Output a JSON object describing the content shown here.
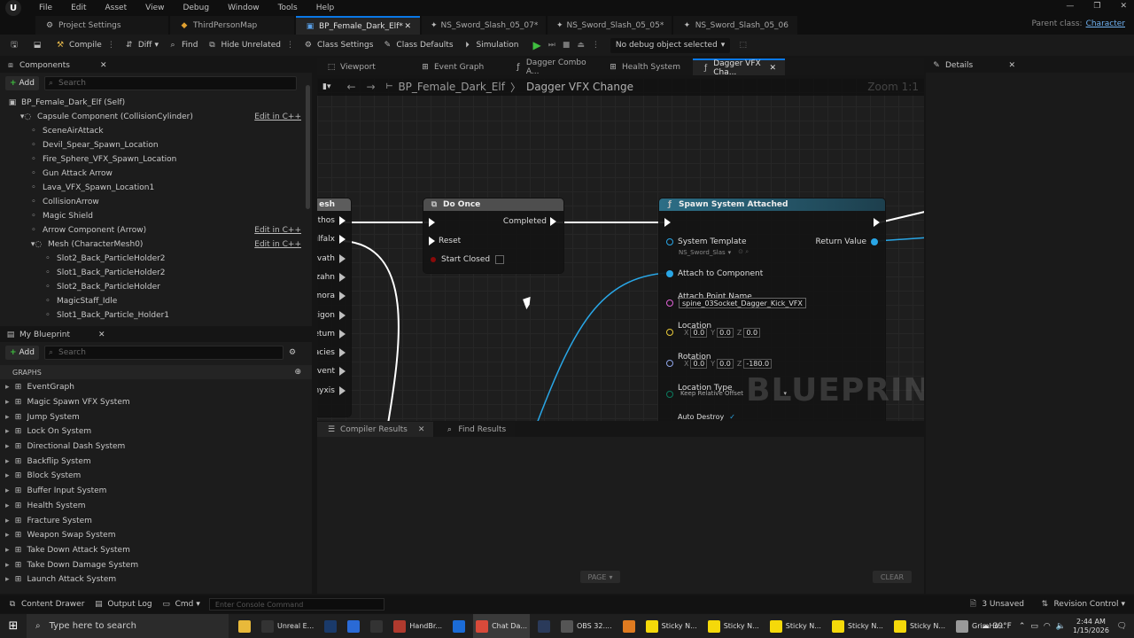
{
  "menu": {
    "items": [
      "File",
      "Edit",
      "Asset",
      "View",
      "Debug",
      "Window",
      "Tools",
      "Help"
    ]
  },
  "tabs": [
    {
      "label": "Project Settings"
    },
    {
      "label": "ThirdPersonMap"
    },
    {
      "label": "BP_Female_Dark_Elf*"
    },
    {
      "label": "NS_Sword_Slash_05_07*"
    },
    {
      "label": "NS_Sword_Slash_05_05*"
    },
    {
      "label": "NS_Sword_Slash_05_06"
    }
  ],
  "parent_class": {
    "label": "Parent class:",
    "value": "Character"
  },
  "toolbar": {
    "compile": "Compile",
    "diff": "Diff",
    "find": "Find",
    "hide_unrelated": "Hide Unrelated",
    "class_settings": "Class Settings",
    "class_defaults": "Class Defaults",
    "simulation": "Simulation",
    "debug_object": "No debug object selected"
  },
  "components": {
    "title": "Components",
    "add": "Add",
    "search_placeholder": "Search",
    "items": [
      {
        "label": "BP_Female_Dark_Elf (Self)",
        "indent": 0,
        "edit": ""
      },
      {
        "label": "Capsule Component (CollisionCylinder)",
        "indent": 1,
        "edit": "Edit in C++"
      },
      {
        "label": "SceneAirAttack",
        "indent": 2,
        "edit": ""
      },
      {
        "label": "Devil_Spear_Spawn_Location",
        "indent": 2,
        "edit": ""
      },
      {
        "label": "Fire_Sphere_VFX_Spawn_Location",
        "indent": 2,
        "edit": ""
      },
      {
        "label": "Gun Attack Arrow",
        "indent": 2,
        "edit": ""
      },
      {
        "label": "Lava_VFX_Spawn_Location1",
        "indent": 2,
        "edit": ""
      },
      {
        "label": "CollisionArrow",
        "indent": 2,
        "edit": ""
      },
      {
        "label": "Magic Shield",
        "indent": 2,
        "edit": ""
      },
      {
        "label": "Arrow Component (Arrow)",
        "indent": 2,
        "edit": "Edit in C++"
      },
      {
        "label": "Mesh (CharacterMesh0)",
        "indent": 2,
        "edit": "Edit in C++"
      },
      {
        "label": "Slot2_Back_ParticleHolder2",
        "indent": 3,
        "edit": ""
      },
      {
        "label": "Slot1_Back_ParticleHolder2",
        "indent": 3,
        "edit": ""
      },
      {
        "label": "Slot2_Back_ParticleHolder",
        "indent": 3,
        "edit": ""
      },
      {
        "label": "MagicStaff_Idle",
        "indent": 3,
        "edit": ""
      },
      {
        "label": "Slot1_Back_Particle_Holder1",
        "indent": 3,
        "edit": ""
      }
    ]
  },
  "my_blueprint": {
    "title": "My Blueprint",
    "add": "Add",
    "search_placeholder": "Search",
    "graphs_header": "GRAPHS",
    "graphs": [
      "EventGraph",
      "Magic Spawn VFX System",
      "Jump System",
      "Lock On System",
      "Directional Dash System",
      "Backflip System",
      "Block System",
      "Buffer Input System",
      "Health System",
      "Fracture System",
      "Weapon Swap System",
      "Take Down Attack System",
      "Take Down Damage System",
      "Launch Attack System"
    ]
  },
  "graph_tabs": [
    {
      "label": "Viewport"
    },
    {
      "label": "Event Graph"
    },
    {
      "label": "Dagger Combo A..."
    },
    {
      "label": "Health System"
    },
    {
      "label": "Dagger VFX Cha..."
    }
  ],
  "details": {
    "title": "Details"
  },
  "breadcrumb": {
    "root": "BP_Female_Dark_Elf",
    "current": "Dagger VFX Change"
  },
  "zoom": "Zoom 1:1",
  "watermark": "BLUEPRINT",
  "left_node": {
    "title": "esh",
    "pins": [
      "uthos",
      "ulfalx",
      "lvath",
      "zahn",
      "mora",
      "tigon",
      "etum",
      "acies",
      "elvent",
      "nyxis"
    ]
  },
  "do_once": {
    "title": "Do Once",
    "completed": "Completed",
    "reset": "Reset",
    "start_closed": "Start Closed"
  },
  "spawn": {
    "title": "Spawn System Attached",
    "system_template": "System Template",
    "template_value": "NS_Sword_Slas",
    "return_value": "Return Value",
    "attach_to_component": "Attach to Component",
    "attach_point_name": "Attach Point Name",
    "attach_point_value": "spine_03Socket_Dagger_Kick_VFX",
    "location": "Location",
    "location_vals": [
      "0.0",
      "0.0",
      "0.0"
    ],
    "rotation": "Rotation",
    "rotation_vals": [
      "0.0",
      "0.0",
      "-180.0"
    ],
    "location_type": "Location Type",
    "location_type_value": "Keep Relative Offset",
    "auto_destroy": "Auto Destroy",
    "axis": [
      "X",
      "Y",
      "Z"
    ]
  },
  "bottom_tabs": {
    "compiler_results": "Compiler Results",
    "find_results": "Find Results",
    "page": "PAGE",
    "clear": "CLEAR"
  },
  "status": {
    "content_drawer": "Content Drawer",
    "output_log": "Output Log",
    "cmd": "Cmd",
    "console_placeholder": "Enter Console Command",
    "unsaved": "3 Unsaved",
    "revision": "Revision Control"
  },
  "taskbar": {
    "search_placeholder": "Type here to search",
    "apps": [
      "Unreal E...",
      "HandBr...",
      "Chat Da...",
      "OBS 32....",
      "Sticky N...",
      "Sticky N...",
      "Sticky N...",
      "Sticky N...",
      "Sticky N...",
      "GrimHo..."
    ],
    "weather": "39°F",
    "time": "2:44 AM",
    "date": "1/15/2026"
  },
  "colors": {
    "exec": "#ffffff",
    "object_pin": "#29a6e6",
    "string_pin": "#e062d6",
    "vector_pin": "#e8c93a",
    "rotator_pin": "#8ea5e8",
    "enum_pin": "#0b7a5e",
    "accent": "#0a78e6"
  }
}
